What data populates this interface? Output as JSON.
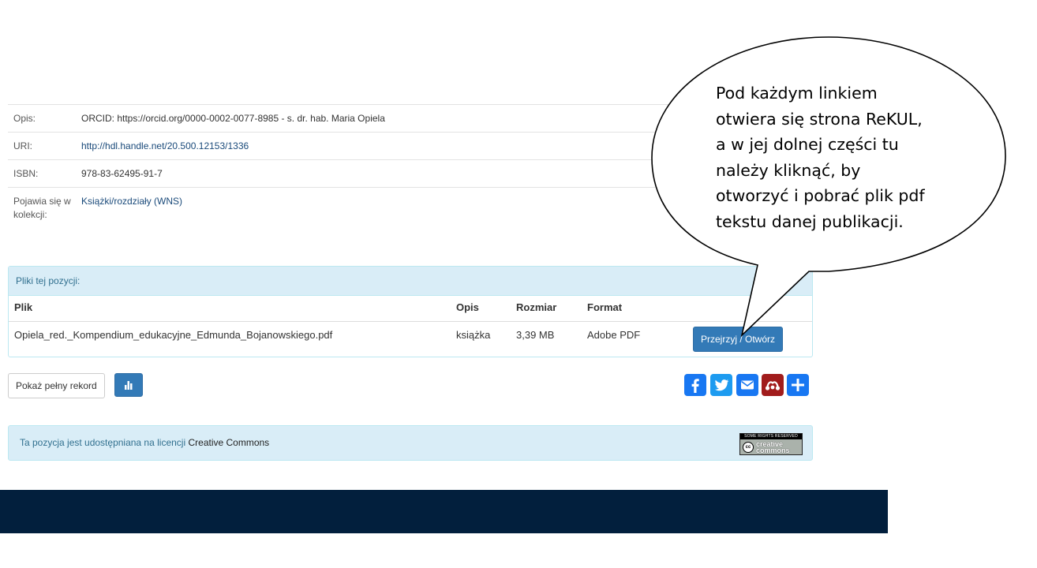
{
  "metadata": [
    {
      "label": "Opis:",
      "value": "ORCID: https://orcid.org/0000-0002-0077-8985 - s. dr. hab. Maria Opiela",
      "link": false
    },
    {
      "label": "URI:",
      "value": "http://hdl.handle.net/20.500.12153/1336",
      "link": true
    },
    {
      "label": "ISBN:",
      "value": "978-83-62495-91-7",
      "link": false
    },
    {
      "label": "Pojawia się w kolekcji:",
      "value": "Książki/rozdziały (WNS)",
      "link": true
    }
  ],
  "files_panel": {
    "heading": "Pliki tej pozycji:",
    "columns": [
      "Plik",
      "Opis",
      "Rozmiar",
      "Format"
    ],
    "rows": [
      {
        "file": "Opiela_red._Kompendium_edukacyjne_Edmunda_Bojanowskiego.pdf",
        "description": "książka",
        "size": "3,39 MB",
        "format": "Adobe PDF",
        "action": "Przejrzyj / Otwórz"
      }
    ]
  },
  "actions": {
    "full_record": "Pokaż pełny rekord",
    "stats_icon": "bar-chart-icon"
  },
  "share": [
    {
      "name": "facebook-icon",
      "color": "#1877f2",
      "glyph": "f"
    },
    {
      "name": "twitter-icon",
      "color": "#1d9bf0",
      "glyph": "t"
    },
    {
      "name": "email-icon",
      "color": "#1877f2",
      "glyph": "e"
    },
    {
      "name": "mendeley-icon",
      "color": "#a11c1c",
      "glyph": "m"
    },
    {
      "name": "add-share-icon",
      "color": "#1877f2",
      "glyph": "+"
    }
  ],
  "license": {
    "text": "Ta pozycja jest udostępniana na licencji",
    "link": "Creative Commons",
    "badge_top": "SOME RIGHTS RESERVED",
    "badge_cc": "cc",
    "badge_bottom_1": "creative",
    "badge_bottom_2": "commons"
  },
  "callout": {
    "lines": [
      "Pod każdym linkiem",
      "otwiera się strona ReKUL,",
      "a w jej dolnej części tu",
      "należy kliknąć, by",
      "otworzyć i pobrać plik pdf",
      "tekstu danej publikacji."
    ]
  },
  "colors": {
    "primary": "#337ab7",
    "info_bg": "#d9edf7",
    "footer": "#021f3d"
  }
}
